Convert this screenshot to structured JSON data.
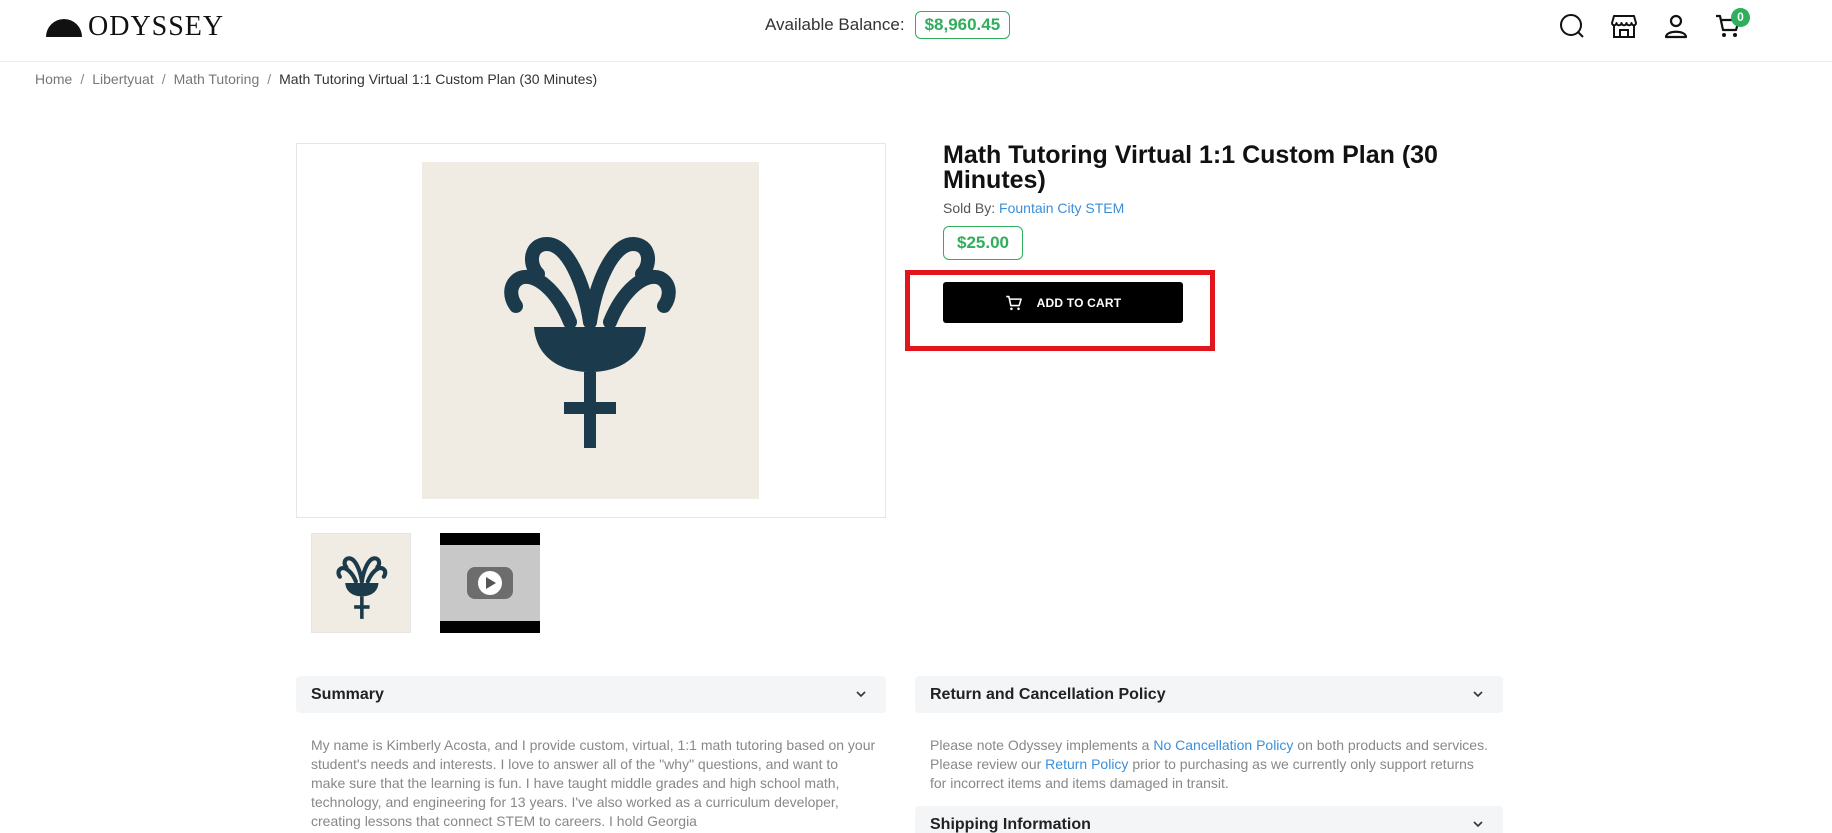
{
  "header": {
    "logo_text": "ODYSSEY",
    "balance_label": "Available Balance:",
    "balance_value": "$8,960.45",
    "cart_count": "0",
    "icons": [
      "search-icon",
      "store-icon",
      "user-icon",
      "cart-icon"
    ]
  },
  "breadcrumb": {
    "items": [
      "Home",
      "Libertyuat",
      "Math Tutoring"
    ],
    "current": "Math Tutoring Virtual 1:1 Custom Plan (30 Minutes)"
  },
  "product": {
    "title": "Math Tutoring Virtual 1:1 Custom Plan (30 Minutes)",
    "sold_by_label": "Sold By:",
    "seller": "Fountain City STEM",
    "price": "$25.00",
    "add_to_cart_label": "ADD TO CART"
  },
  "summary": {
    "heading": "Summary",
    "text": "My name is Kimberly Acosta, and I provide custom, virtual, 1:1 math tutoring based on your student's needs and interests. I love to answer all of the \"why\" questions, and want to make sure that the learning is fun. I have taught middle grades and high school math, technology, and engineering for 13 years. I've also worked as a curriculum developer, creating lessons that connect STEM to careers. I hold Georgia"
  },
  "return_policy": {
    "heading": "Return and Cancellation Policy",
    "text_1": "Please note Odyssey implements a ",
    "link_1": "No Cancellation Policy",
    "text_2": " on both products and services. Please review our ",
    "link_2": "Return Policy",
    "text_3": " prior to purchasing as we currently only support returns for incorrect items and items damaged in transit."
  },
  "shipping": {
    "heading": "Shipping Information"
  },
  "colors": {
    "accent_green": "#2fae5b",
    "link_blue": "#3b8fd9",
    "highlight_red": "#e0161c",
    "icon_navy": "#1b3a4b",
    "art_bg": "#f0ebe3"
  }
}
